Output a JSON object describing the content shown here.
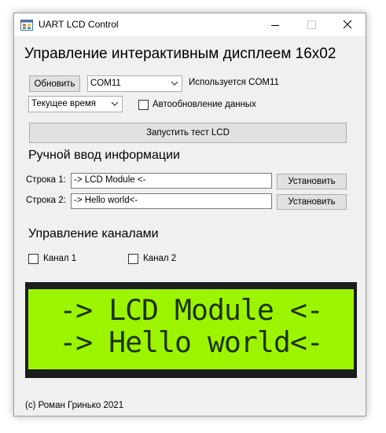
{
  "window": {
    "title": "UART LCD Control",
    "icons": {
      "app": "app-icon",
      "minimize": "minimize-icon",
      "maximize": "maximize-icon",
      "close": "close-icon"
    }
  },
  "main": {
    "heading": "Управление интерактивным дисплеем 16x02"
  },
  "connection": {
    "refresh_label": "Обновить",
    "port_value": "COM11",
    "status_text": "Используется COM11",
    "mode_value": "Текущее время",
    "auto_update_label": "Автообновление данных",
    "auto_update_checked": false,
    "test_button_label": "Запустить тест LCD"
  },
  "manual": {
    "heading": "Ручной ввод информации",
    "line1_label": "Строка 1:",
    "line1_value": "-> LCD Module <-",
    "line1_set_label": "Установить",
    "line2_label": "Строка 2:",
    "line2_value": "-> Hello world<-",
    "line2_set_label": "Установить"
  },
  "channels": {
    "heading": "Управление каналами",
    "channel1_label": "Канал 1",
    "channel1_checked": false,
    "channel2_label": "Канал 2",
    "channel2_checked": false
  },
  "lcd": {
    "line1": "-> LCD Module <-",
    "line2": "-> Hello world<-",
    "background_color": "#9df400",
    "text_color": "#1c3304"
  },
  "footer": {
    "copyright": "(c) Роман Гринько 2021"
  }
}
